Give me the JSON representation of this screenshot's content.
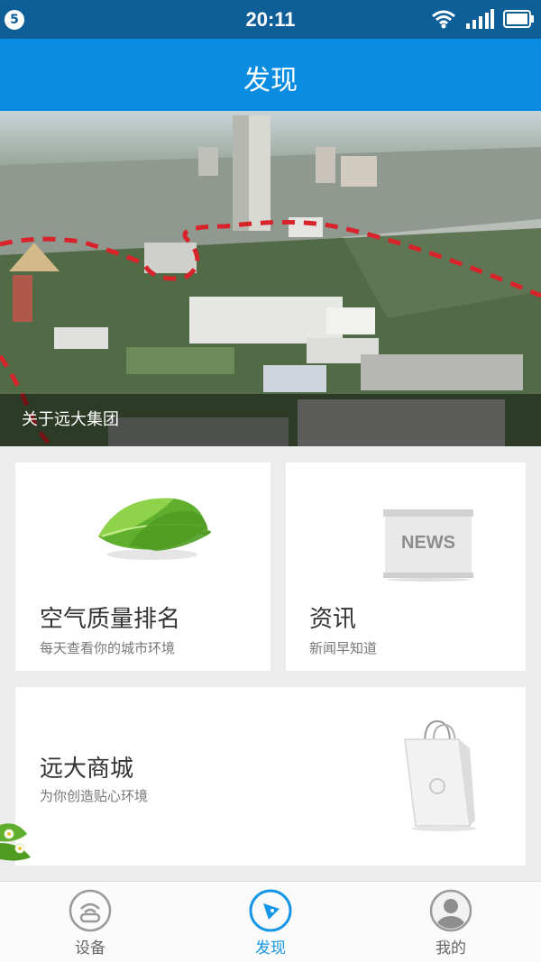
{
  "status_bar": {
    "badge": "5",
    "time": "20:11",
    "icons": [
      "wifi-icon",
      "signal-icon",
      "battery-icon"
    ]
  },
  "app_bar": {
    "title": "发现"
  },
  "banner": {
    "caption": "关于远大集团"
  },
  "cards": {
    "air": {
      "title": "空气质量排名",
      "subtitle": "每天查看你的城市环境",
      "icon": "leaf-icon"
    },
    "news": {
      "title": "资讯",
      "subtitle": "新闻早知道",
      "icon": "news-board-icon",
      "board_text": "NEWS"
    },
    "shop": {
      "title": "远大商城",
      "subtitle": "为你创造贴心环境",
      "icon": "shopping-bag-icon"
    }
  },
  "bottom_nav": {
    "items": [
      {
        "label": "设备",
        "icon": "device-icon",
        "active": false
      },
      {
        "label": "发现",
        "icon": "compass-icon",
        "active": true
      },
      {
        "label": "我的",
        "icon": "user-icon",
        "active": false
      }
    ]
  },
  "colors": {
    "status_bar": "#0e5f97",
    "app_bar": "#0a8de0",
    "accent": "#1596e6",
    "background": "#ececec"
  }
}
